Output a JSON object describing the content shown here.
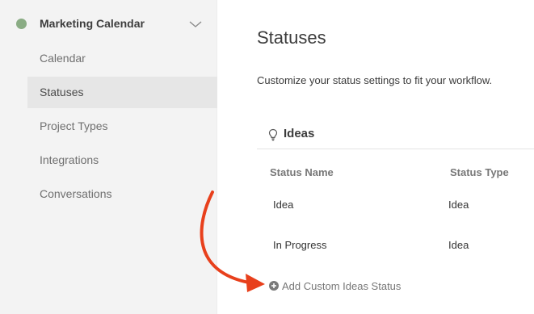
{
  "sidebar": {
    "project": {
      "name": "Marketing Calendar",
      "dot_color": "#8aac84",
      "expand_icon": "chevron-down-icon"
    },
    "items": [
      {
        "label": "Calendar",
        "active": false
      },
      {
        "label": "Statuses",
        "active": true
      },
      {
        "label": "Project Types",
        "active": false
      },
      {
        "label": "Integrations",
        "active": false
      },
      {
        "label": "Conversations",
        "active": false
      }
    ]
  },
  "main": {
    "title": "Statuses",
    "description": "Customize your status settings to fit your workflow.",
    "section": {
      "icon": "lightbulb-icon",
      "title": "Ideas",
      "columns": [
        "Status Name",
        "Status Type"
      ],
      "rows": [
        {
          "name": "Idea",
          "type": "Idea"
        },
        {
          "name": "In Progress",
          "type": "Idea"
        }
      ],
      "add_link": {
        "icon": "plus-circle-icon",
        "label": "Add Custom Ideas Status"
      }
    }
  },
  "annotation": {
    "type": "curved-arrow",
    "color": "#e8401c"
  }
}
